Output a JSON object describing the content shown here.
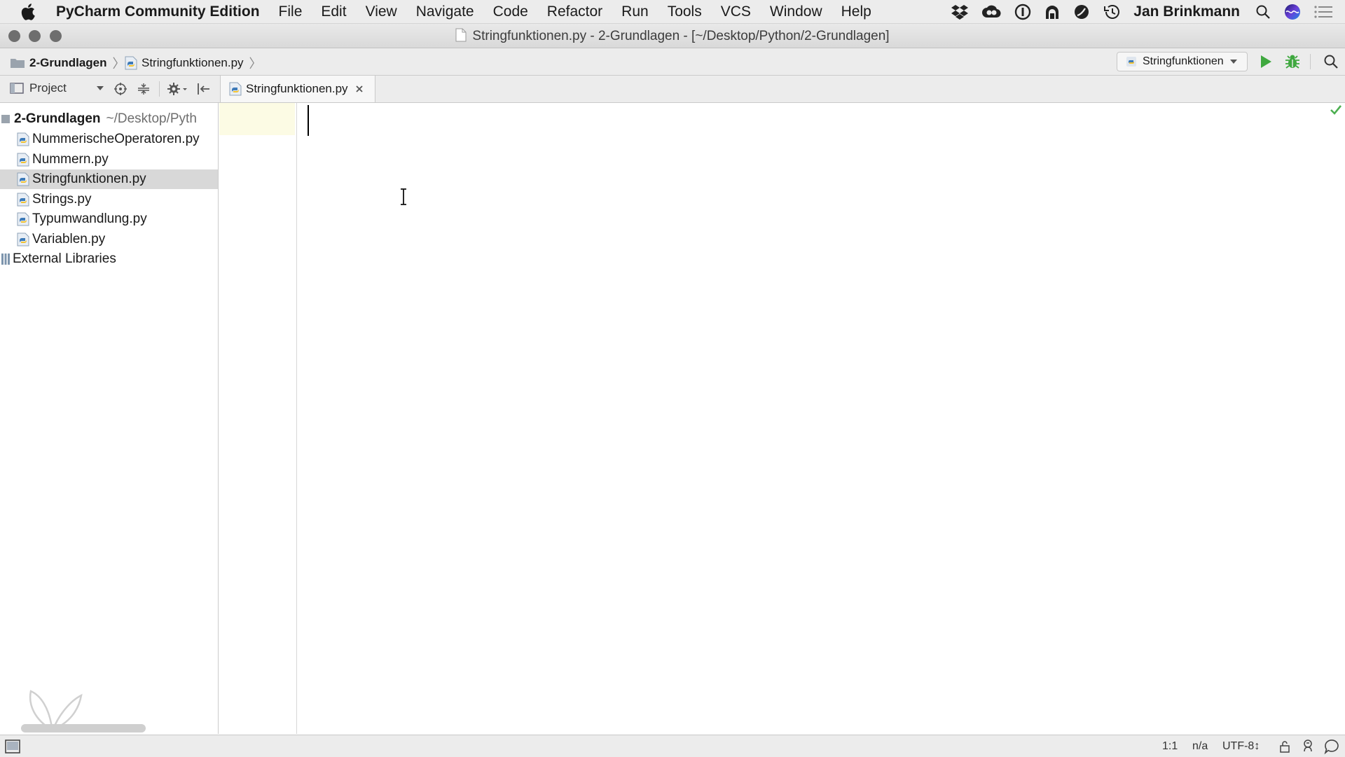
{
  "menubar": {
    "app_name": "PyCharm Community Edition",
    "items": [
      "File",
      "Edit",
      "View",
      "Navigate",
      "Code",
      "Refactor",
      "Run",
      "Tools",
      "VCS",
      "Window",
      "Help"
    ],
    "tray_icons": [
      "dropbox-icon",
      "creative-cloud-icon",
      "1password-icon",
      "app-icon",
      "vpn-icon",
      "time-machine-icon"
    ],
    "user": "Jan Brinkmann"
  },
  "window": {
    "title": "Stringfunktionen.py - 2-Grundlagen - [~/Desktop/Python/2-Grundlagen]"
  },
  "navbar": {
    "breadcrumbs": [
      "2-Grundlagen",
      "Stringfunktionen.py"
    ],
    "run_config": "Stringfunktionen"
  },
  "toolwindow": {
    "view_label": "Project"
  },
  "tabs": [
    {
      "label": "Stringfunktionen.py",
      "active": true
    }
  ],
  "project_tree": {
    "root": {
      "name": "2-Grundlagen",
      "path": "~/Desktop/Pyth"
    },
    "files": [
      {
        "name": "NummerischeOperatoren.py",
        "selected": false
      },
      {
        "name": "Nummern.py",
        "selected": false
      },
      {
        "name": "Stringfunktionen.py",
        "selected": true
      },
      {
        "name": "Strings.py",
        "selected": false
      },
      {
        "name": "Typumwandlung.py",
        "selected": false
      },
      {
        "name": "Variablen.py",
        "selected": false
      }
    ],
    "libraries": "External Libraries"
  },
  "statusbar": {
    "position": "1:1",
    "context": "n/a",
    "encoding": "UTF-8↕"
  },
  "colors": {
    "run_green": "#3fa83f",
    "check_green": "#4caf50",
    "selection": "#d8d8d8",
    "current_line": "#fcfbe4"
  }
}
